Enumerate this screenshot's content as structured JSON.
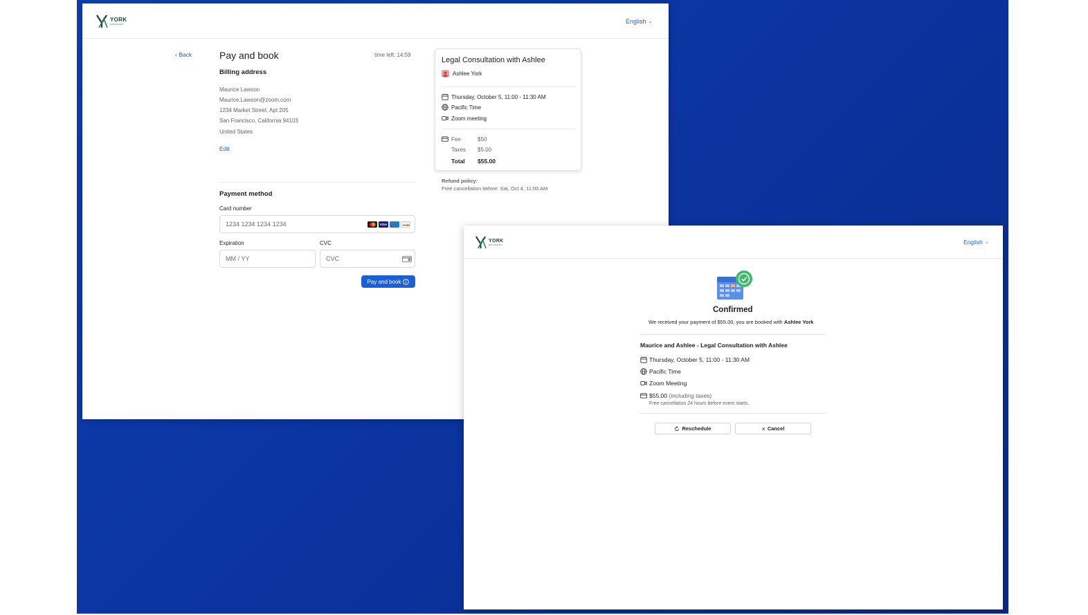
{
  "brand": {
    "name": "YORK",
    "tagline": "ADVISORY"
  },
  "language": {
    "label": "English"
  },
  "checkout": {
    "back_label": "Back",
    "title": "Pay and book",
    "timer": "time left: 14:59",
    "billing": {
      "heading": "Billing address",
      "name": "Maurice Lawson",
      "email": "Maurice.Lawson@zoom.com",
      "street": "1234 Market Street, Apt 205",
      "city": "San Francisco, California 94103",
      "country": "United States",
      "edit_label": "Edit"
    },
    "payment": {
      "heading": "Payment method",
      "card_label": "Card number",
      "card_placeholder": "1234 1234 1234 1234",
      "expiration_label": "Expiration",
      "expiration_placeholder": "MM / YY",
      "cvc_label": "CVC",
      "cvc_placeholder": "CVC",
      "submit_label": "Pay and book"
    },
    "summary": {
      "title": "Legal Consultation with Ashlee",
      "host": "Ashlee York",
      "datetime": "Thursday, October 5, 11:00 - 11:30 AM",
      "timezone": "Pacific Time",
      "location": "Zoom meeting",
      "fee_label": "Fee",
      "fee_value": "$50",
      "taxes_label": "Taxes",
      "taxes_value": "$5.00",
      "total_label": "Total",
      "total_value": "$55.00"
    },
    "refund": {
      "heading": "Refund policy:",
      "text": "Free cancellation before:  Sat, Oct 4, 11:00 AM"
    }
  },
  "confirmation": {
    "title": "Confirmed",
    "message_prefix": "We received your payment of $55.00, you are booked with ",
    "message_name": "Ashlee York",
    "event_title": "Maurice and Ashlee - Legal Consultation with Ashlee",
    "datetime": "Thursday, October 5, 11:00 - 11:30 AM",
    "timezone": "Pacific Time",
    "location": "Zoom Meeting",
    "price": "$55.00",
    "price_note": " (including taxes)",
    "cancellation_note": "Free cancellation 24 hours before event starts.",
    "reschedule_label": "Reschedule",
    "cancel_label": "Cancel"
  },
  "colors": {
    "accent": "#1a5fd6",
    "brand_green": "#0f4a2a",
    "success": "#3dbb68",
    "background": "#0b36a3"
  }
}
